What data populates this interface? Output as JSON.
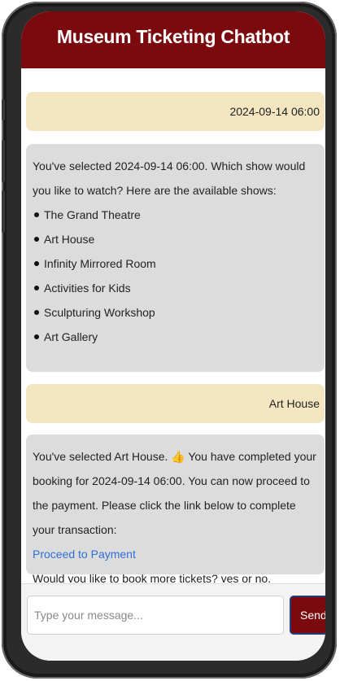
{
  "header": {
    "title": "Museum Ticketing Chatbot"
  },
  "messages": [
    {
      "from": "user",
      "text": "2024-09-14 06:00"
    },
    {
      "from": "bot",
      "text": "You've selected 2024-09-14 06:00. Which show would you like to watch? Here are the available shows:",
      "shows": [
        "The Grand Theatre",
        "Art House",
        "Infinity Mirrored Room",
        "Activities for Kids",
        "Sculpturing Workshop",
        "Art Gallery"
      ]
    },
    {
      "from": "user",
      "text": "Art House"
    },
    {
      "from": "bot",
      "text_before_emoji": "You've selected Art House.",
      "emoji": "👍",
      "text_after_emoji": "You have completed your booking for 2024-09-14 06:00. You can now proceed to the payment. Please click the link below to complete your transaction:",
      "link_text": "Proceed to Payment",
      "followup": "Would you like to book more tickets? yes or no."
    }
  ],
  "input": {
    "placeholder": "Type your message...",
    "value": ""
  },
  "send_label": "Send",
  "colors": {
    "header": "#7b0a0e",
    "user_bubble": "#f3e6c1",
    "bot_bubble": "#dcdcdc",
    "link": "#2f6fd6"
  }
}
